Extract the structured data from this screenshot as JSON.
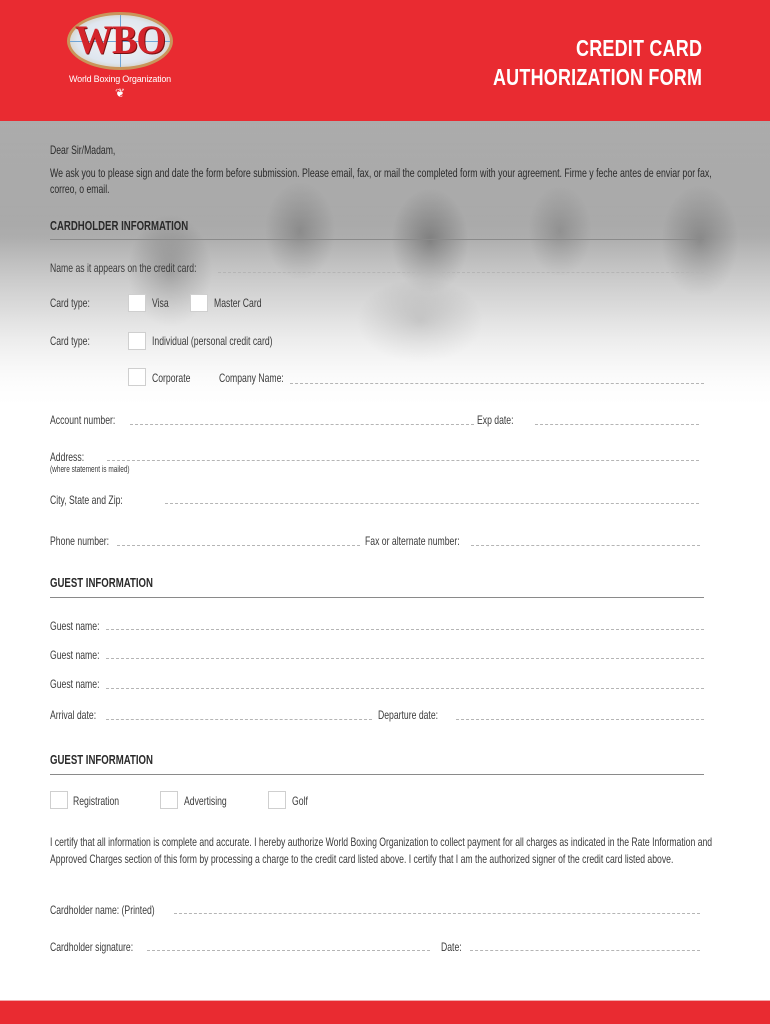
{
  "header": {
    "logo_text": "WBO",
    "logo_subtitle": "World Boxing Organization",
    "title_line1": "CREDIT CARD",
    "title_line2": "AUTHORIZATION FORM",
    "brand_color": "#e92b31"
  },
  "intro": {
    "greeting": "Dear Sir/Madam,",
    "line1": "We ask you to please sign and date the form before submission.  Please email, fax, or mail the completed form with your agreement.  Firme y feche antes de enviar por fax,",
    "line2": "correo, o email."
  },
  "cardholder": {
    "heading": "CARDHOLDER INFORMATION",
    "name_label": "Name as it appears on the credit card:",
    "card_type_label": "Card type:",
    "visa_label": "Visa",
    "mastercard_label": "Master Card",
    "card_type2_label": "Card type:",
    "individual_label": "Individual (personal credit card)",
    "corporate_label": "Corporate",
    "company_name_label": "Company Name:",
    "account_label": "Account number:",
    "exp_label": "Exp date:",
    "address_label": "Address:",
    "address_note": "(where statement is mailed)",
    "city_label": "City, State and Zip:",
    "phone_label": "Phone number:",
    "fax_label": "Fax or alternate number:"
  },
  "guest": {
    "heading": "GUEST INFORMATION",
    "guest_names": [
      "Guest name:",
      "Guest name:",
      "Guest name:"
    ],
    "arrival_label": "Arrival date:",
    "departure_label": "Departure date:"
  },
  "charges": {
    "heading": "GUEST INFORMATION",
    "options": [
      "Registration",
      "Advertising",
      "Golf"
    ]
  },
  "certification": {
    "line1": "I certify that all information is complete and accurate.  I hereby authorize World Boxing Organization to collect payment for all charges as indicated in the Rate Information and",
    "line2": "Approved Charges section of this form by processing a charge to the credit card listed above.   I certify that I am the authorized signer of the credit card listed above."
  },
  "signature": {
    "printed_name_label": "Cardholder name:  (Printed)",
    "signature_label": "Cardholder signature:",
    "date_label": "Date:"
  }
}
